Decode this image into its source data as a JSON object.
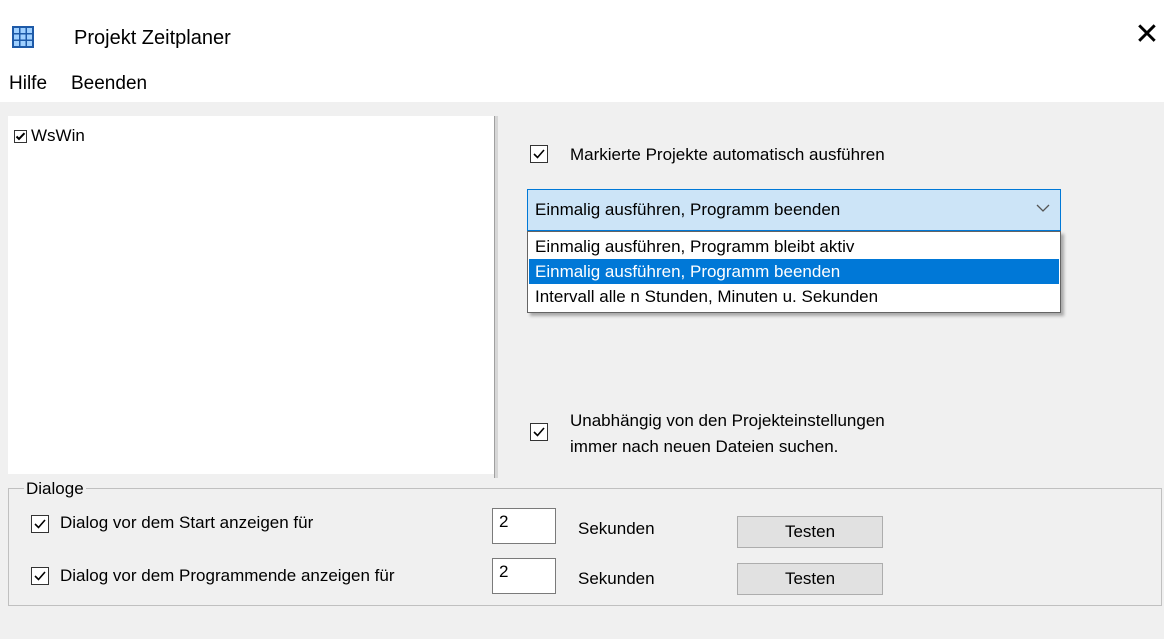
{
  "window": {
    "title": "Projekt Zeitplaner",
    "app_icon": "grid-app-icon",
    "close_glyph": "✕"
  },
  "menu": {
    "items": [
      "Hilfe",
      "Beenden"
    ]
  },
  "tree": {
    "items": [
      {
        "label": "WsWin",
        "checked": true
      }
    ]
  },
  "options": {
    "auto_run_label": "Markierte Projekte automatisch ausführen",
    "auto_run_checked": true,
    "mode_selected": "Einmalig ausführen, Programm beenden",
    "mode_options": [
      "Einmalig ausführen, Programm bleibt aktiv",
      "Einmalig ausführen, Programm beenden",
      "Intervall alle n Stunden, Minuten u. Sekunden"
    ],
    "independent_label_line1": "Unabhängig von den Projekteinstellungen",
    "independent_label_line2": "immer nach neuen Dateien suchen.",
    "independent_checked": true
  },
  "dialogs": {
    "group_title": "Dialoge",
    "start": {
      "label": "Dialog vor dem Start anzeigen für",
      "checked": true,
      "value": "2",
      "unit": "Sekunden",
      "button": "Testen"
    },
    "end": {
      "label": "Dialog vor dem Programmende anzeigen für",
      "checked": true,
      "value": "2",
      "unit": "Sekunden",
      "button": "Testen"
    }
  },
  "colors": {
    "accent": "#0078d7",
    "combo_bg": "#cce4f7",
    "window_bg": "#f0f0f0"
  }
}
